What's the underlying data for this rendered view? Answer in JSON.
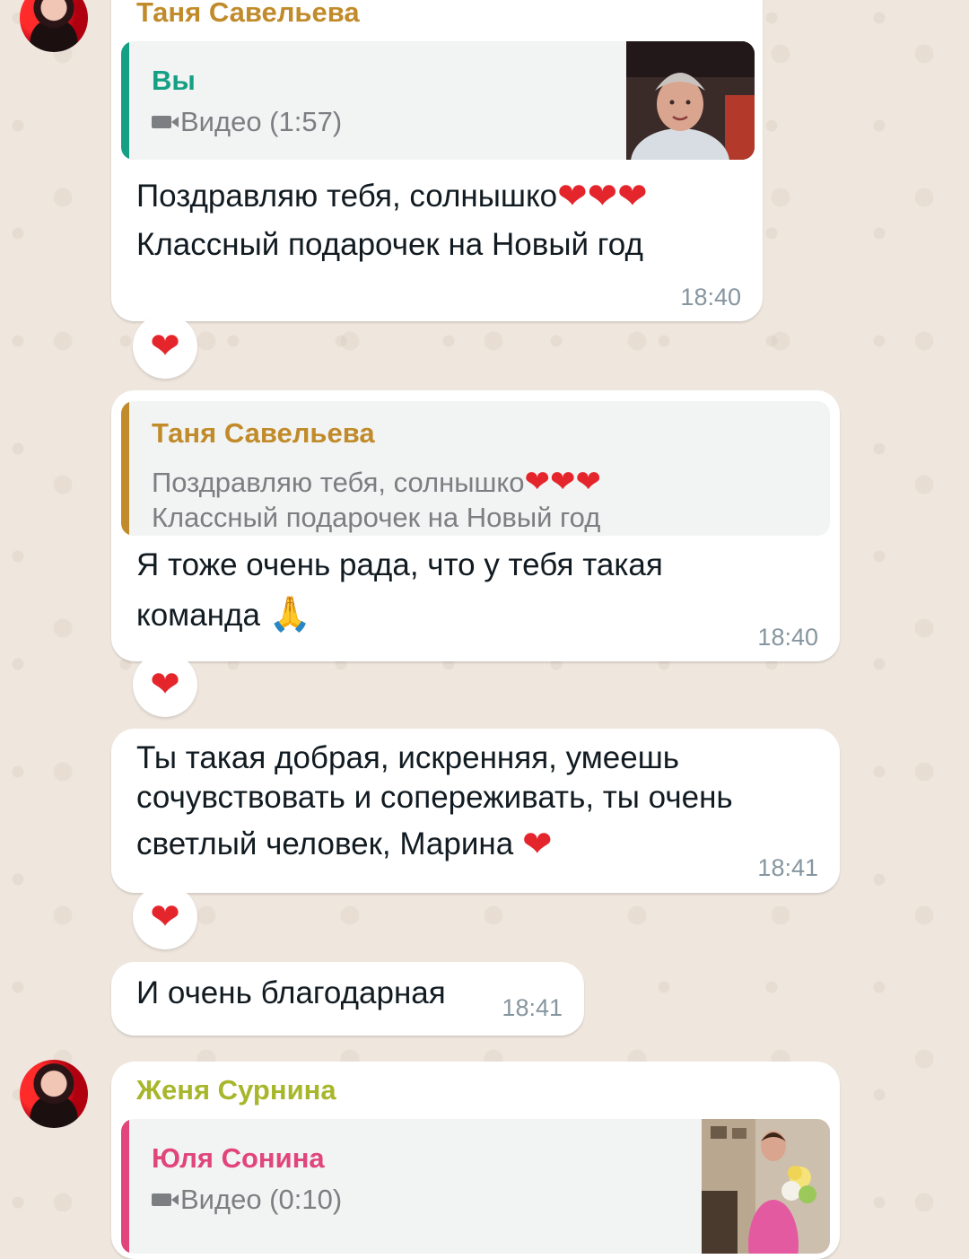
{
  "messages": [
    {
      "sender": "Таня Савельева",
      "sender_color": "#c18b2b",
      "reply": {
        "author": "Вы",
        "author_color": "#15a085",
        "video_label": "Видео (1:57)"
      },
      "text_line1": "Поздравляю тебя, солнышко",
      "text_line2": "Классный подарочек на Новый год",
      "time": "18:40",
      "reaction": "heart"
    },
    {
      "reply": {
        "author": "Таня Савельева",
        "author_color": "#c18b2b",
        "line1": "Поздравляю тебя, солнышко",
        "line2": "Классный подарочек на Новый год"
      },
      "text_line1": "Я тоже очень рада, что у тебя такая",
      "text_line2": "команда",
      "time": "18:40",
      "reaction": "heart"
    },
    {
      "text_line1": "Ты такая добрая, искренняя, умеешь",
      "text_line2": "сочувствовать и сопереживать, ты очень",
      "text_line3": "светлый человек, Марина",
      "time": "18:41",
      "reaction": "heart"
    },
    {
      "text_line1": "И очень благодарная",
      "time": "18:41"
    },
    {
      "sender": "Женя Сурнина",
      "sender_color": "#a8b62c",
      "reply": {
        "author": "Юля Сонина",
        "author_color": "#e0457b",
        "video_label": "Видео (0:10)"
      }
    }
  ],
  "colors": {
    "heart": "#e5252c",
    "bubble": "#ffffff",
    "wallpaper": "#efe7de",
    "time": "#8696a0"
  }
}
